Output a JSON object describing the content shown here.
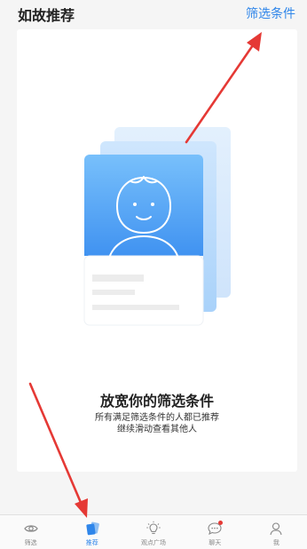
{
  "header": {
    "title": "如故推荐",
    "filter_link": "筛选条件"
  },
  "empty_state": {
    "title": "放宽你的筛选条件",
    "line1": "所有满足筛选条件的人都已推荐",
    "line2": "继续滑动查看其他人"
  },
  "tabs": [
    {
      "label": "筛选",
      "icon": "eye-icon",
      "active": false
    },
    {
      "label": "推荐",
      "icon": "cards-icon",
      "active": true
    },
    {
      "label": "观点广场",
      "icon": "bulb-icon",
      "active": false
    },
    {
      "label": "聊天",
      "icon": "chat-icon",
      "active": false,
      "badge": true
    },
    {
      "label": "我",
      "icon": "person-icon",
      "active": false
    }
  ],
  "colors": {
    "accent": "#2f86ea",
    "illustration_blue": "#5aa8f5",
    "annotation_red": "#e53935"
  }
}
